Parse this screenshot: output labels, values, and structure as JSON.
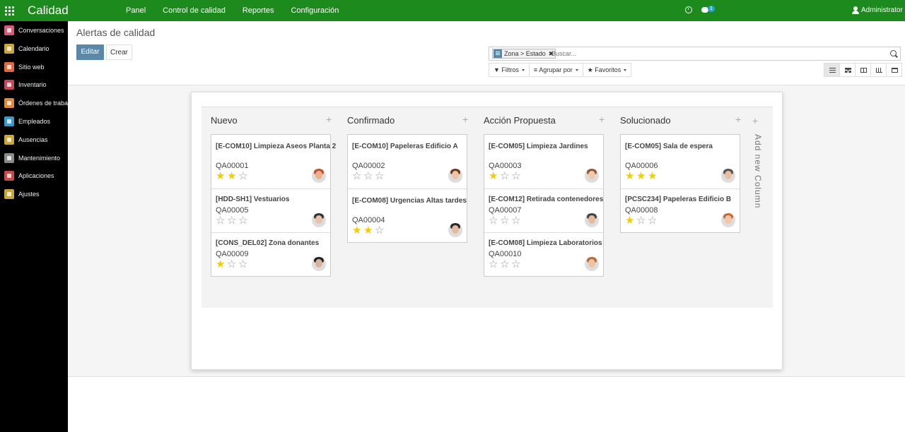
{
  "app": {
    "title": "Calidad"
  },
  "topmenu": [
    "Panel",
    "Control de calidad",
    "Reportes",
    "Configuración"
  ],
  "systray": {
    "chat_badge": "1",
    "user": "Administrator"
  },
  "sidebar": {
    "items": [
      {
        "label": "Conversaciones",
        "icon": "conversations-icon",
        "color": "#d35d7a"
      },
      {
        "label": "Calendario",
        "icon": "calendar-icon",
        "color": "#c9a63a"
      },
      {
        "label": "Sitio web",
        "icon": "website-icon",
        "color": "#e06a3a"
      },
      {
        "label": "Inventario",
        "icon": "inventory-icon",
        "color": "#c2495a"
      },
      {
        "label": "Órdenes de trabajo",
        "icon": "work-orders-icon",
        "color": "#e0893a"
      },
      {
        "label": "Empleados",
        "icon": "employees-icon",
        "color": "#3a9ac9"
      },
      {
        "label": "Ausencias",
        "icon": "leaves-icon",
        "color": "#c9a63a"
      },
      {
        "label": "Mantenimiento",
        "icon": "maintenance-icon",
        "color": "#8a8a8a"
      },
      {
        "label": "Aplicaciones",
        "icon": "apps-icon",
        "color": "#c94a4a"
      },
      {
        "label": "Ajustes",
        "icon": "settings-icon",
        "color": "#c9a63a"
      }
    ]
  },
  "control": {
    "title": "Alertas de calidad",
    "edit_label": "Editar",
    "create_label": "Crear",
    "facet_label": "Zona > Estado",
    "search_placeholder": "Buscar...",
    "filters_label": "Filtros",
    "groupby_label": "Agrupar por",
    "favorites_label": "Favoritos",
    "views": [
      "list",
      "kanban",
      "grid",
      "graph",
      "calendar"
    ],
    "active_view": "list"
  },
  "kanban": {
    "add_column_label": "Add new Column",
    "star_color": "#f3cc00",
    "columns": [
      {
        "title": "Nuevo",
        "cards": [
          {
            "title": "[E-COM10] Limpieza Aseos Planta 2",
            "code": "QA00001",
            "stars": 2
          },
          {
            "title": "[HDD-SH1] Vestuarios",
            "code": "QA00005",
            "stars": 0
          },
          {
            "title": "[CONS_DEL02] Zona donantes",
            "code": "QA00009",
            "stars": 1
          }
        ]
      },
      {
        "title": "Confirmado",
        "cards": [
          {
            "title": "[E-COM10] Papeleras Edificio A",
            "code": "QA00002",
            "stars": 0
          },
          {
            "title": "[E-COM08] Urgencias Altas tardes",
            "code": "QA00004",
            "stars": 2
          }
        ]
      },
      {
        "title": "Acción Propuesta",
        "cards": [
          {
            "title": "[E-COM05] Limpieza Jardines",
            "code": "QA00003",
            "stars": 1
          },
          {
            "title": "[E-COM12] Retirada contenedores",
            "code": "QA00007",
            "stars": 0
          },
          {
            "title": "[E-COM08] Limpieza Laboratorios",
            "code": "QA00010",
            "stars": 0
          }
        ]
      },
      {
        "title": "Solucionado",
        "cards": [
          {
            "title": "[E-COM05] Sala de espera",
            "code": "QA00006",
            "stars": 3
          },
          {
            "title": "[PCSC234] Papeleras Edificio B",
            "code": "QA00008",
            "stars": 1
          }
        ]
      }
    ]
  }
}
